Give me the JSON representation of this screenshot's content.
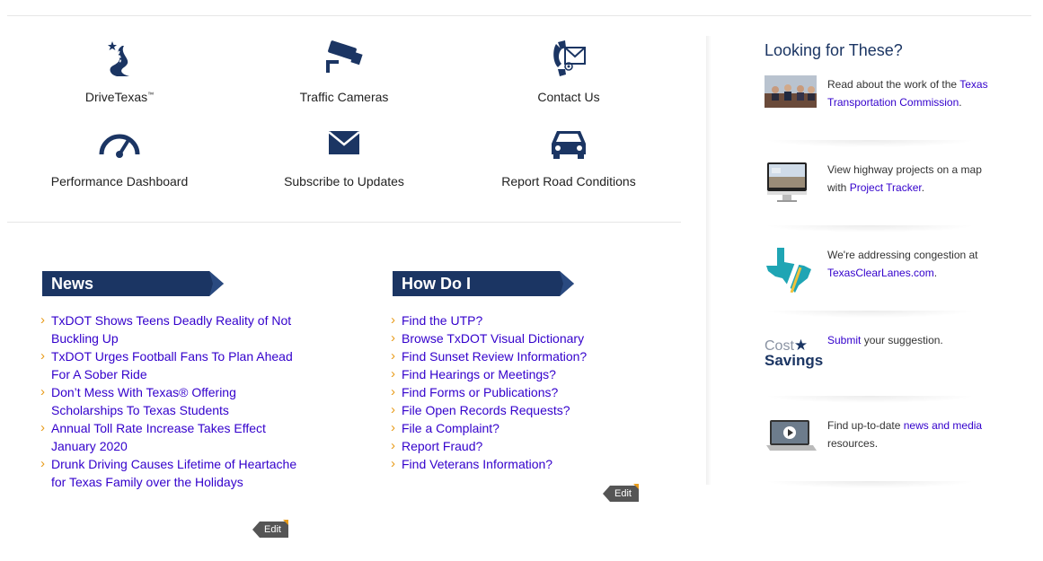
{
  "quick_links": [
    {
      "label": "DriveTexas",
      "tm": "™",
      "icon": "road-star-icon"
    },
    {
      "label": "Traffic Cameras",
      "icon": "camera-icon"
    },
    {
      "label": "Contact Us",
      "icon": "phone-mail-icon"
    },
    {
      "label": "Performance Dashboard",
      "icon": "gauge-icon"
    },
    {
      "label": "Subscribe to Updates",
      "icon": "envelope-icon"
    },
    {
      "label": "Report Road Conditions",
      "icon": "car-icon"
    }
  ],
  "news": {
    "title": "News",
    "items": [
      "TxDOT Shows Teens Deadly Reality of Not Buckling Up",
      "TxDOT Urges Football Fans To Plan Ahead For A Sober Ride",
      "Don’t Mess With Texas® Offering Scholarships To Texas Students",
      "Annual Toll Rate Increase Takes Effect January 2020",
      "Drunk Driving Causes Lifetime of Heartache for Texas Family over the Holidays"
    ],
    "edit_label": "Edit"
  },
  "how_do_i": {
    "title": "How Do I",
    "items": [
      "Find the UTP?",
      "Browse TxDOT Visual Dictionary",
      "Find Sunset Review Information?",
      "Find Hearings or Meetings?",
      "Find Forms or Publications?",
      "File Open Records Requests?",
      "File a Complaint?",
      "Report Fraud?",
      "Find Veterans Information?"
    ],
    "edit_label": "Edit"
  },
  "sidebar": {
    "title": "Looking for These?",
    "items": [
      {
        "pre": "Read about the work of the ",
        "link": "Texas Transportation Commission",
        "post": "."
      },
      {
        "pre": "View highway projects on a map with ",
        "link": "Project Tracker",
        "post": "."
      },
      {
        "pre": "We're addressing congestion at ",
        "link": "TexasClearLanes.com",
        "post": "."
      },
      {
        "pre": "",
        "link": "Submit",
        "post": " your suggestion."
      },
      {
        "pre": "Find up-to-date ",
        "link": "news and media",
        "post": " resources."
      }
    ],
    "cost_savings_text": [
      "Cost",
      "Savings"
    ]
  },
  "colors": {
    "navy": "#1b3563",
    "link": "#3300cc",
    "bullet": "#e89c1b"
  }
}
